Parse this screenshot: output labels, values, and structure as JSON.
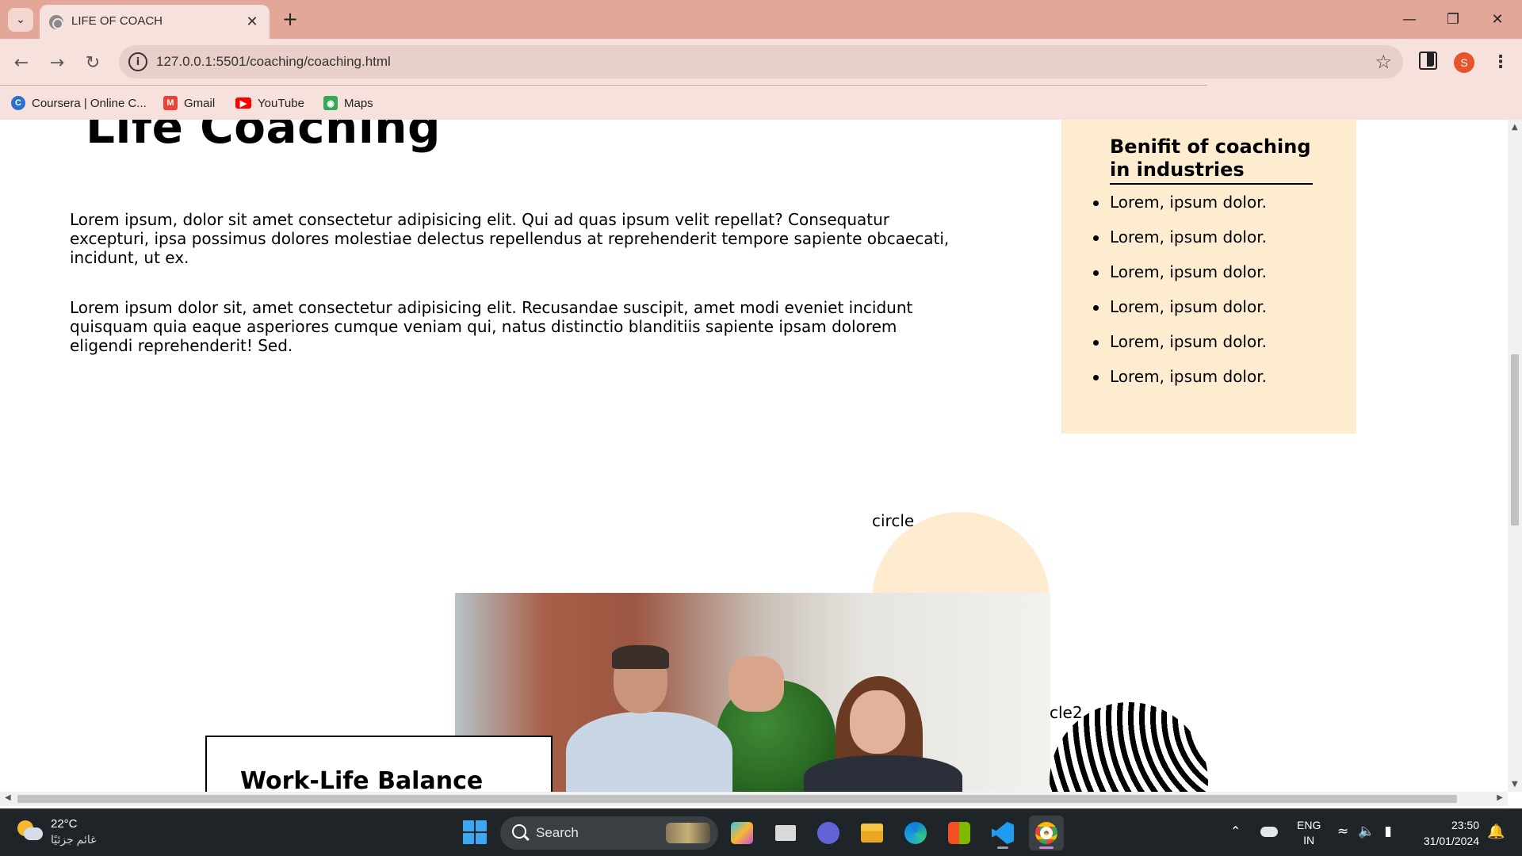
{
  "browser": {
    "tab_title": "LIFE OF COACH",
    "url": "127.0.0.1:5501/coaching/coaching.html",
    "avatar_initial": "S",
    "bookmarks": [
      {
        "label": "Coursera | Online C...",
        "icon": "coursera-icon",
        "color": "#2a73cc"
      },
      {
        "label": "Gmail",
        "icon": "gmail-icon",
        "color": "#ea4335"
      },
      {
        "label": "YouTube",
        "icon": "youtube-icon",
        "color": "#ff0000"
      },
      {
        "label": "Maps",
        "icon": "maps-icon",
        "color": "#34a853"
      }
    ],
    "colors": {
      "tab_strip": "#e2a799",
      "toolbar": "#f7e1dc"
    }
  },
  "page": {
    "title": "Life Coaching",
    "paragraphs": [
      "Lorem ipsum, dolor sit amet consectetur adipisicing elit. Qui ad quas ipsum velit repellat? Consequatur excepturi, ipsa possimus dolores molestiae delectus repellendus at reprehenderit tempore sapiente obcaecati, incidunt, ut ex.",
      "Lorem ipsum dolor sit, amet consectetur adipisicing elit. Recusandae suscipit, amet modi eveniet incidunt quisquam quia eaque asperiores cumque veniam qui, natus distinctio blanditiis sapiente ipsam dolorem eligendi reprehenderit! Sed."
    ],
    "sidebar": {
      "title": "Benifit of coaching in industries",
      "items": [
        "Lorem, ipsum dolor.",
        "Lorem, ipsum dolor.",
        "Lorem, ipsum dolor.",
        "Lorem, ipsum dolor.",
        "Lorem, ipsum dolor.",
        "Lorem, ipsum dolor."
      ],
      "bg_color": "#feecd0"
    },
    "circle_label": "circle",
    "circle2_label": "cle2",
    "card_title": "Work-Life Balance"
  },
  "taskbar": {
    "weather_temp": "22°C",
    "weather_desc": "غائم جزئيًا",
    "search_placeholder": "Search",
    "lang_line1": "ENG",
    "lang_line2": "IN",
    "time": "23:50",
    "date": "31/01/2024",
    "apps": [
      "copilot-icon",
      "task-view-icon",
      "teams-icon",
      "file-explorer-icon",
      "edge-icon",
      "store-icon",
      "vscode-icon",
      "chrome-icon"
    ]
  }
}
